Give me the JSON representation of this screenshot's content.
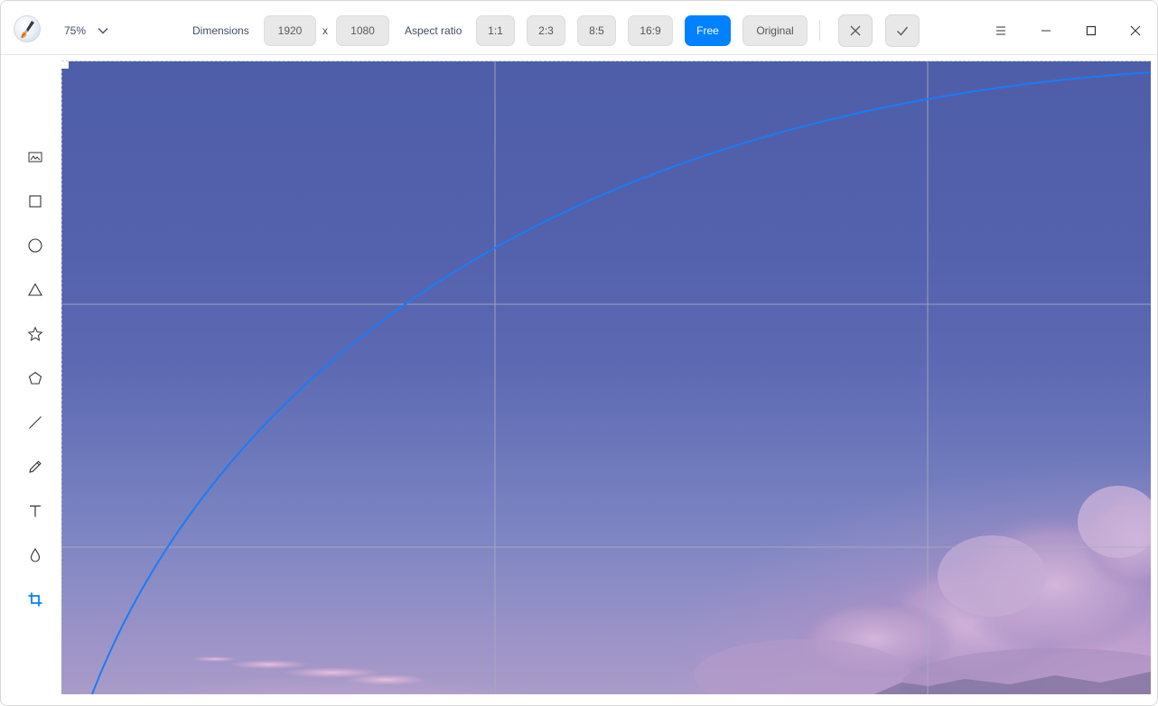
{
  "toolbar": {
    "zoom_value": "75%",
    "dimensions_label": "Dimensions",
    "width_value": "1920",
    "x_separator": "x",
    "height_value": "1080",
    "aspect_ratio_label": "Aspect ratio",
    "ratios": [
      {
        "label": "1:1",
        "active": false
      },
      {
        "label": "2:3",
        "active": false
      },
      {
        "label": "8:5",
        "active": false
      },
      {
        "label": "16:9",
        "active": false
      },
      {
        "label": "Free",
        "active": true
      },
      {
        "label": "Original",
        "active": false
      }
    ],
    "cancel_icon": "close-icon",
    "confirm_icon": "check-icon"
  },
  "window_controls": [
    "menu-icon",
    "minimize-icon",
    "maximize-icon",
    "close-icon"
  ],
  "tools": [
    {
      "name": "image-icon",
      "active": false
    },
    {
      "name": "rectangle-icon",
      "active": false
    },
    {
      "name": "ellipse-icon",
      "active": false
    },
    {
      "name": "triangle-icon",
      "active": false
    },
    {
      "name": "star-icon",
      "active": false
    },
    {
      "name": "pentagon-icon",
      "active": false
    },
    {
      "name": "line-icon",
      "active": false
    },
    {
      "name": "pencil-icon",
      "active": false
    },
    {
      "name": "text-icon",
      "active": false
    },
    {
      "name": "blur-icon",
      "active": false
    },
    {
      "name": "crop-icon",
      "active": true
    }
  ],
  "colors": {
    "accent": "#0081ff",
    "rotation_arc": "#1a7cf5",
    "grid_lines": "#9aa0b8",
    "sky_top": "#4f5ea9",
    "sky_bottom": "#a99bc9"
  }
}
